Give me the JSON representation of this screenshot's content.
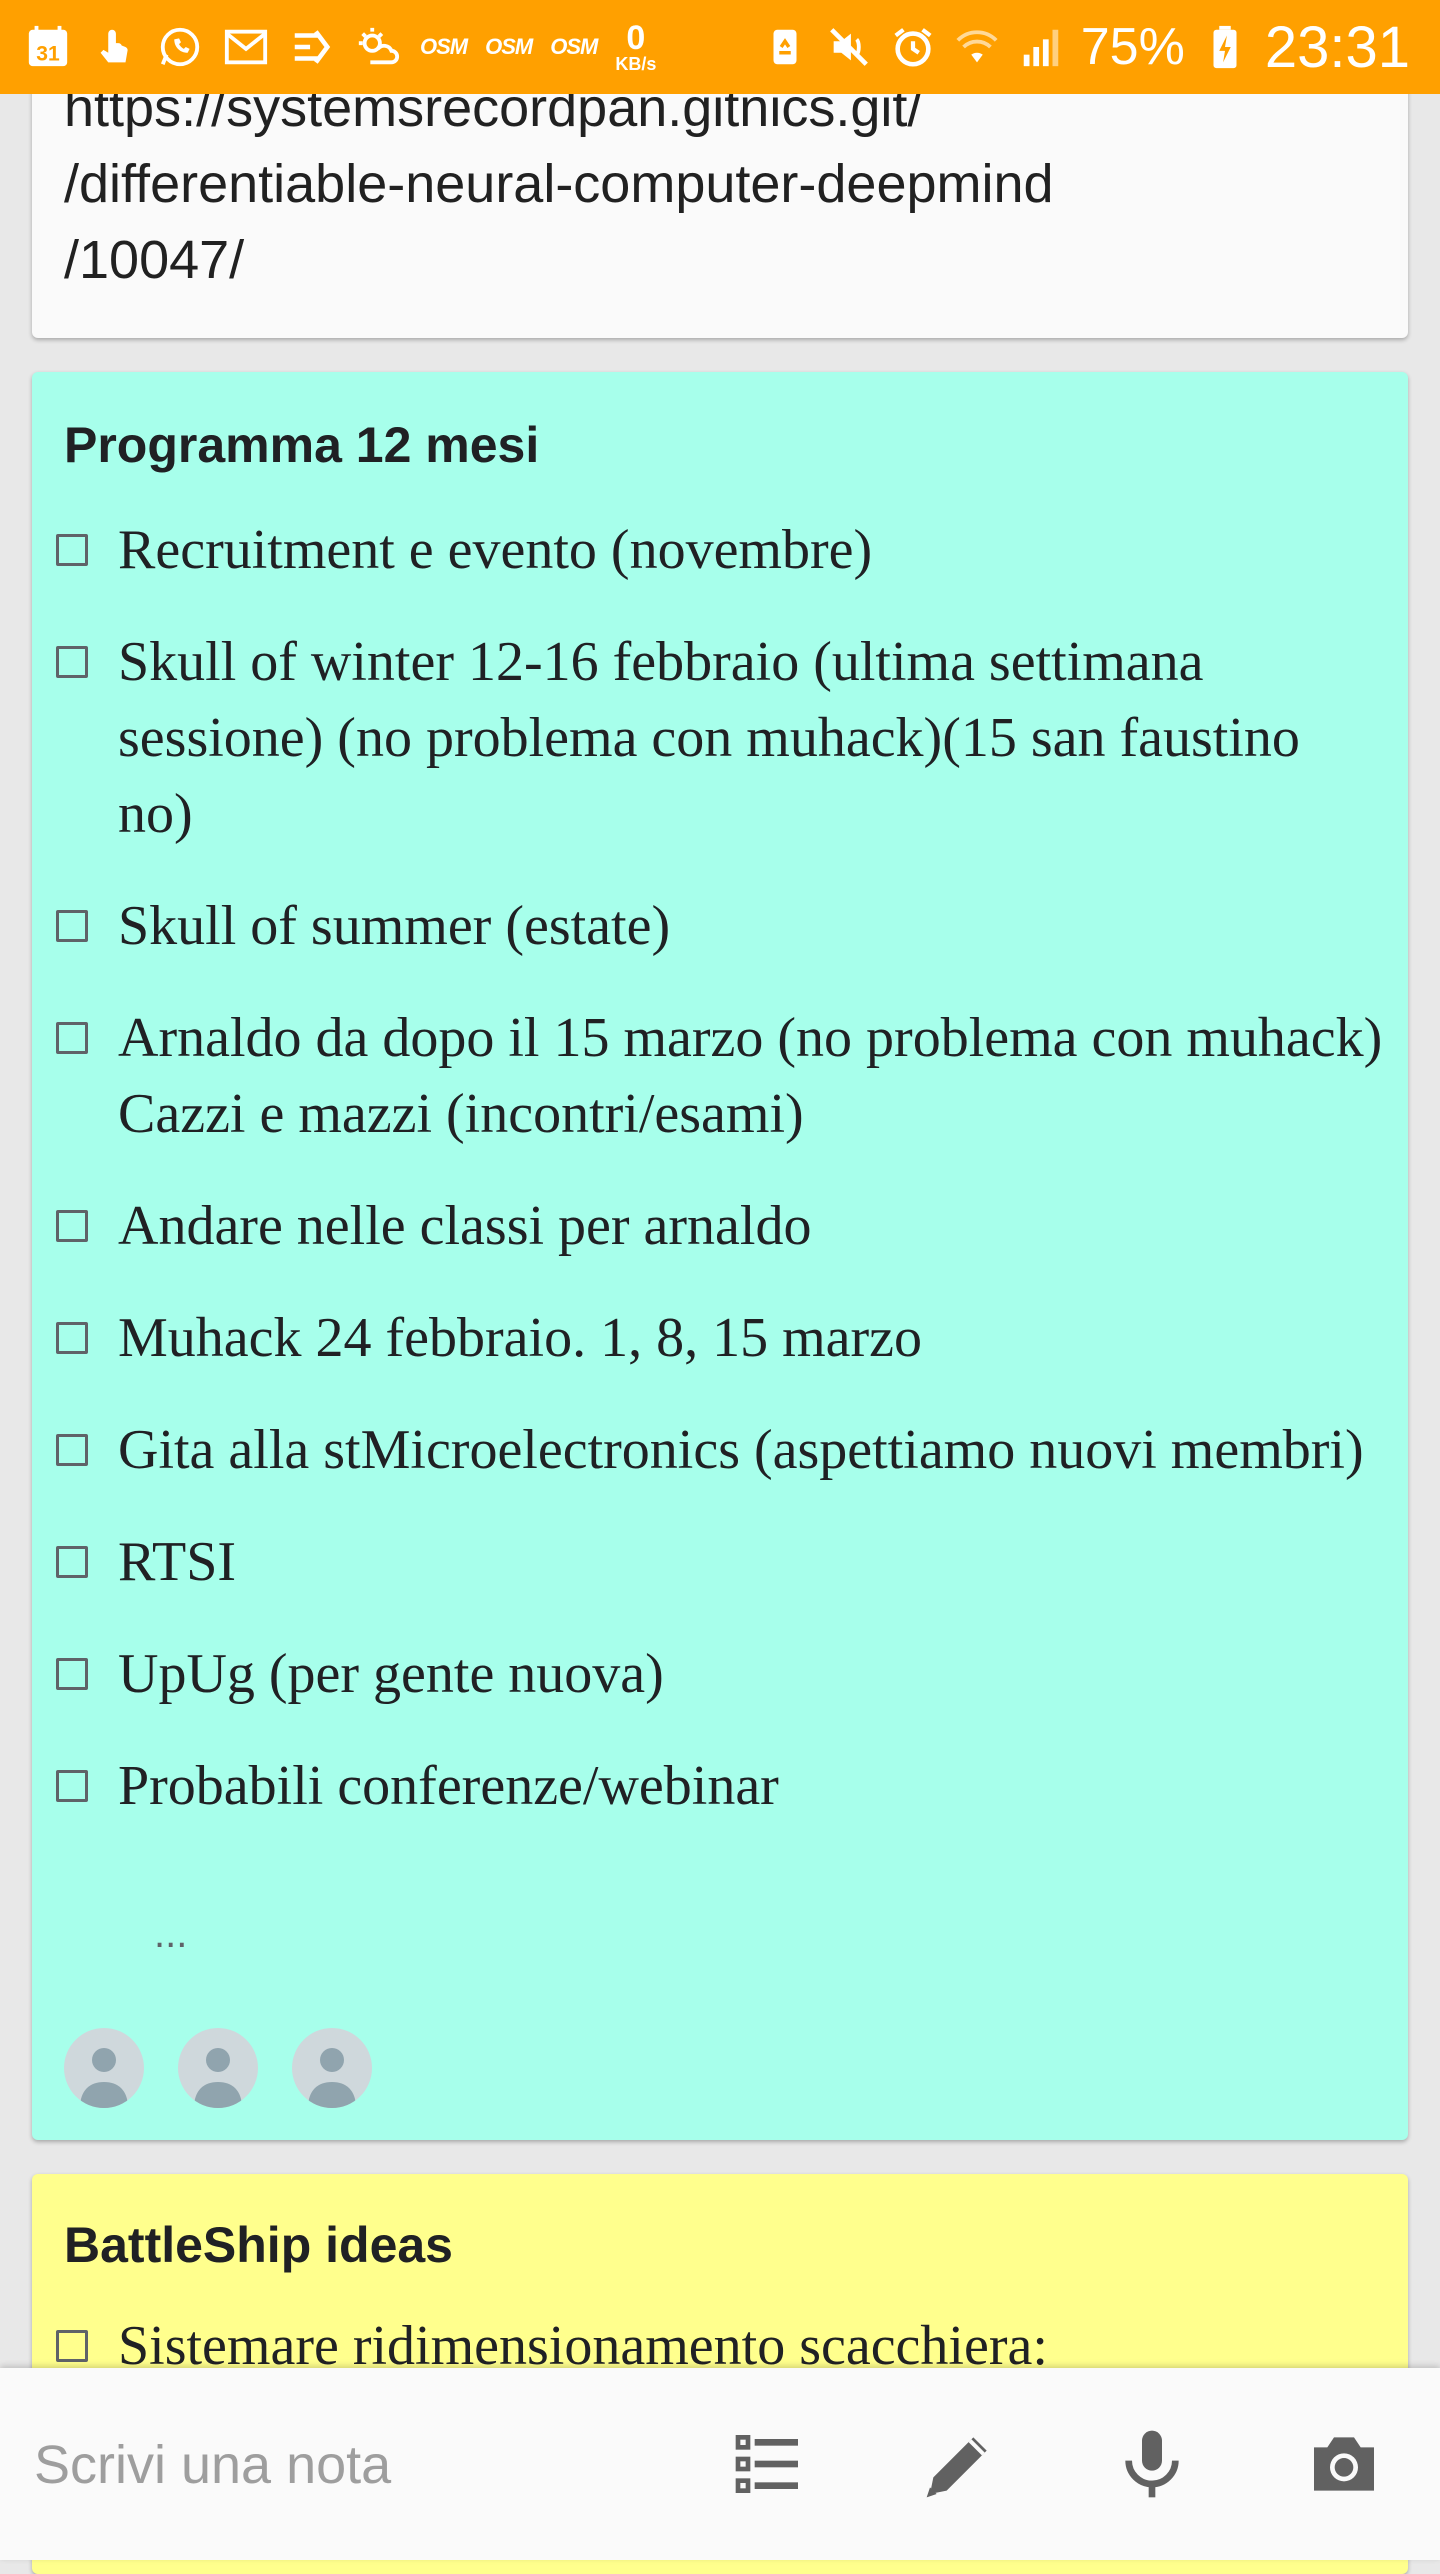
{
  "status_bar": {
    "left_icons": [
      "calendar-icon",
      "touch-icon",
      "whatsapp-icon",
      "mail-icon",
      "trending-icon",
      "weather-icon"
    ],
    "calendar_day": "31",
    "osm_labels": [
      "OSM",
      "OSM",
      "OSM"
    ],
    "net_speed_value": "0",
    "net_speed_unit": "KB/s",
    "right_icons": [
      "recycle-icon",
      "mute-icon",
      "alarm-icon",
      "wifi-icon",
      "signal-icon"
    ],
    "battery_percent": "75%",
    "time": "23:31",
    "background_color": "#ffa000"
  },
  "notes": {
    "link_card": {
      "link_text": "https://systemsrecordpan.gitnics.git/\n/differentiable-neural-computer-deepmind\n/10047/",
      "background_color": "#fafafa"
    },
    "program_card": {
      "title": "Programma 12 mesi",
      "background_color": "#a7ffeb",
      "items": [
        "Recruitment e evento (novembre)",
        "Skull of winter 12-16 febbraio (ultima settimana sessione) (no problema con muhack)(15 san faustino no)",
        "Skull of summer (estate)",
        "Arnaldo da dopo il 15 marzo (no problema con muhack) Cazzi e mazzi (incontri/esami)",
        "Andare nelle classi per arnaldo",
        "Muhack 24 febbraio. 1, 8, 15 marzo",
        "Gita alla stMicroelectronics (aspettiamo nuovi membri)",
        "RTSI",
        "UpUg (per gente nuova)",
        "Probabili conferenze/webinar"
      ],
      "more_indicator": "...",
      "collaborators": [
        "avatar",
        "avatar",
        "avatar"
      ]
    },
    "battleship_card": {
      "title": "BattleShip ideas",
      "background_color": "#ffff8d",
      "items": [
        "Sistemare ridimensionamento scacchiera:"
      ]
    }
  },
  "bottom_bar": {
    "placeholder": "Scrivi una nota",
    "actions": [
      {
        "name": "new-list-button",
        "icon": "list-icon"
      },
      {
        "name": "new-drawing-button",
        "icon": "pen-icon"
      },
      {
        "name": "new-audio-button",
        "icon": "mic-icon"
      },
      {
        "name": "new-photo-button",
        "icon": "camera-icon"
      }
    ]
  }
}
